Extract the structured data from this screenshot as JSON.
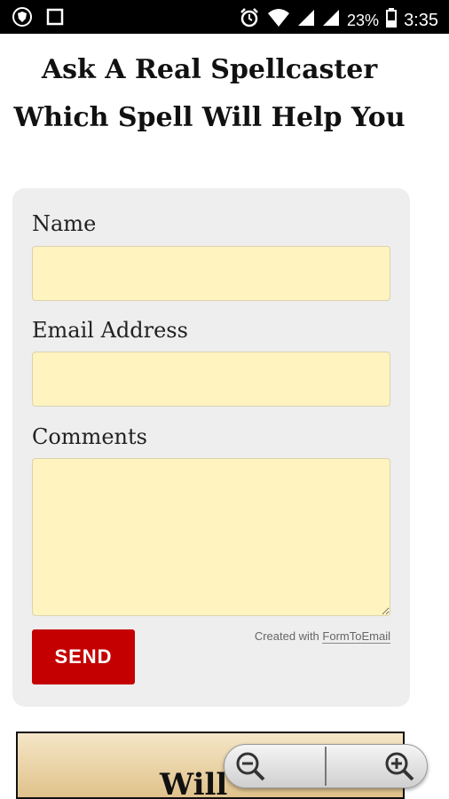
{
  "status_bar": {
    "battery": "23%",
    "time": "3:35",
    "icons": [
      "shield-icon",
      "square-icon",
      "alarm-icon",
      "wifi-icon",
      "signal-icon",
      "signal-icon",
      "battery-icon"
    ]
  },
  "title": {
    "line1": "Ask A Real Spellcaster",
    "line2": "Which Spell Will Help You"
  },
  "form": {
    "name_label": "Name",
    "name_value": "",
    "email_label": "Email Address",
    "email_value": "",
    "comments_label": "Comments",
    "comments_value": "",
    "send_label": "SEND",
    "credit_prefix": "Created with",
    "credit_link": "FormToEmail"
  },
  "banner": {
    "text": "Will"
  },
  "zoom": {
    "icons": [
      "zoom-out-icon",
      "zoom-in-icon"
    ]
  }
}
